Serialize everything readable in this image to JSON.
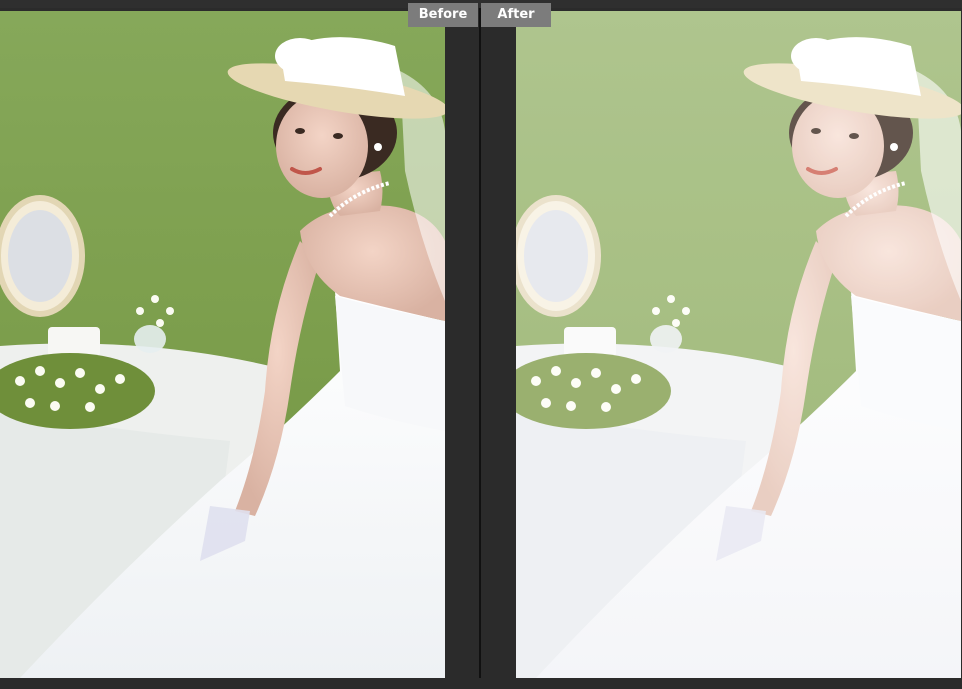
{
  "compare_view": {
    "before_label": "Before",
    "after_label": "After"
  },
  "colors": {
    "tab_background": "#7c7c7c",
    "tab_text": "#ffffff",
    "app_background": "#2b2b2b",
    "grass_before": "#7ea04f",
    "grass_after": "#9ab870"
  }
}
